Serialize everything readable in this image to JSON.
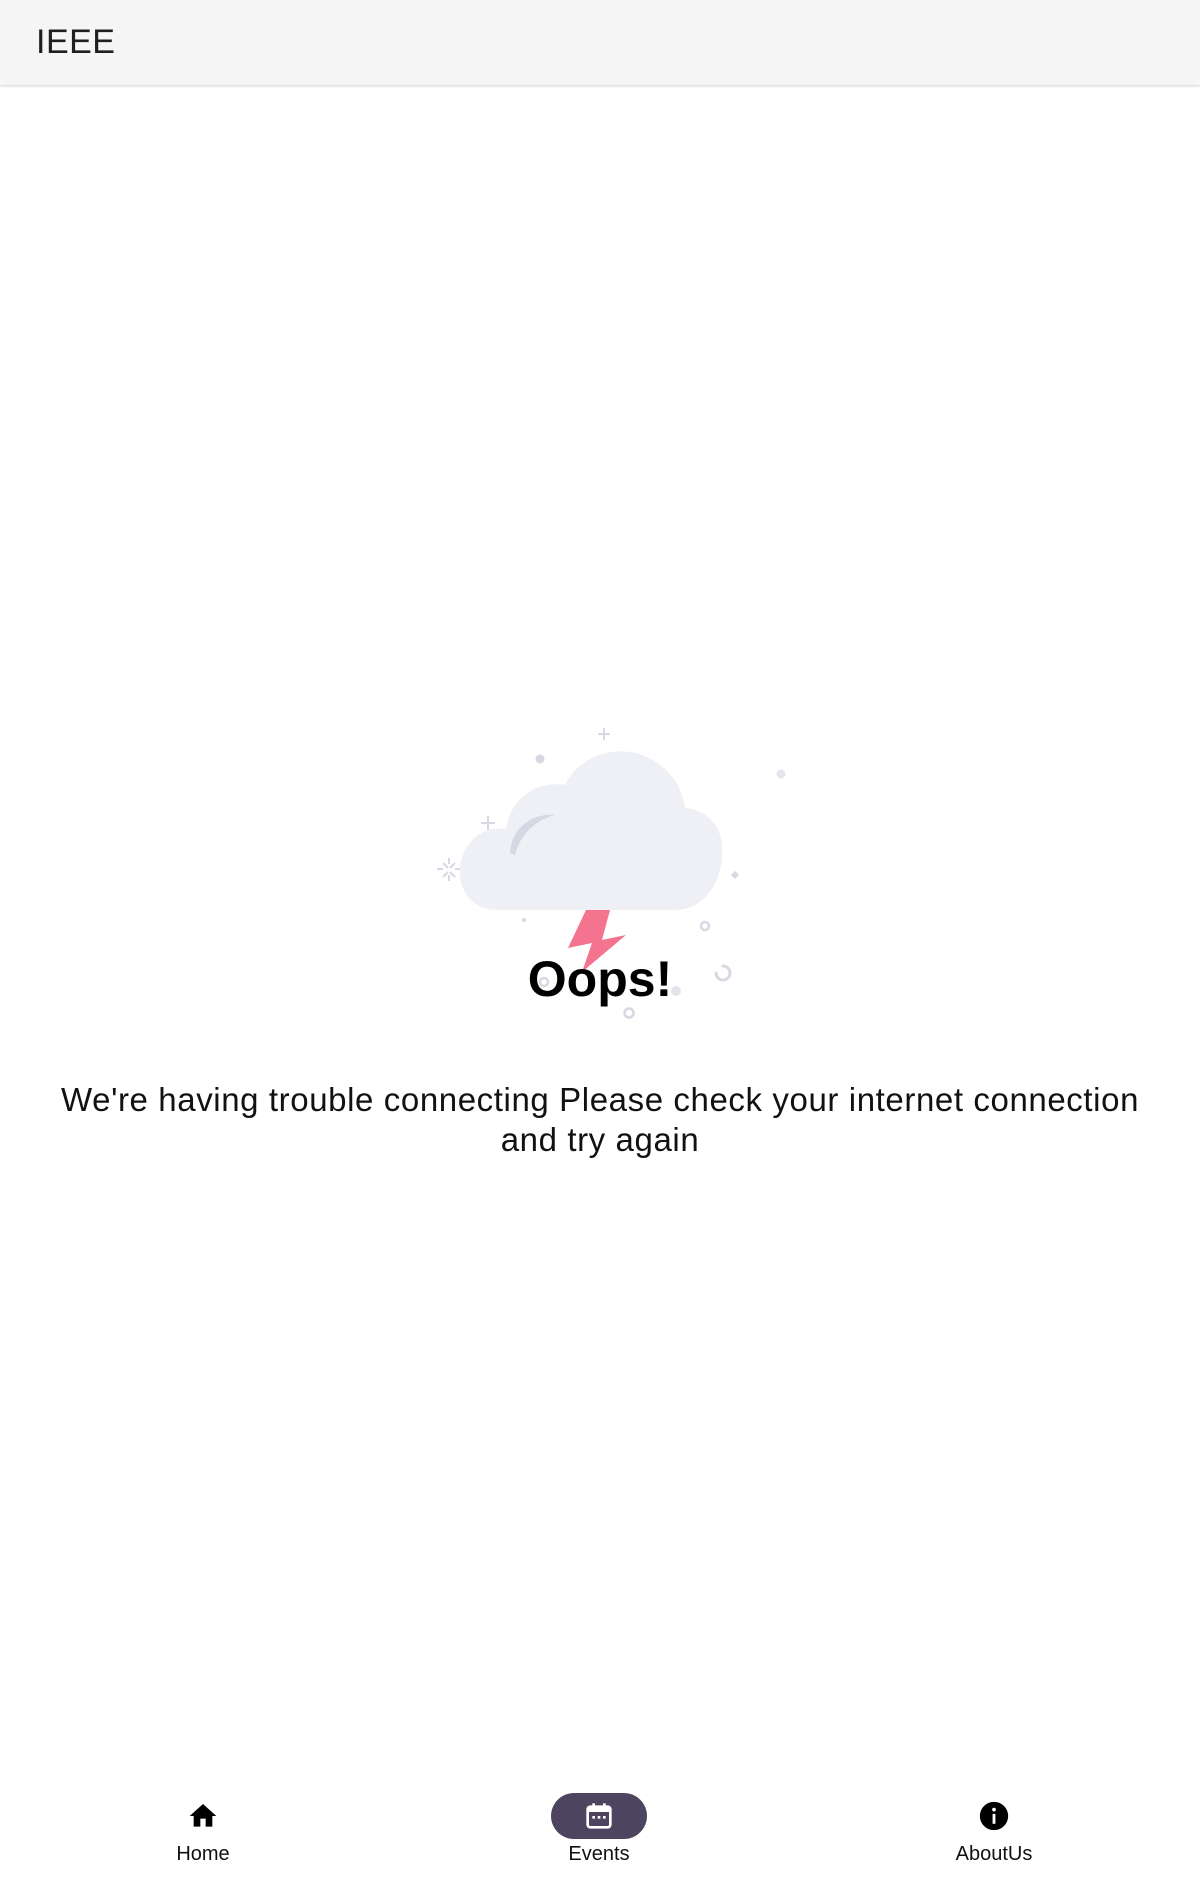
{
  "app_bar": {
    "title": "IEEE"
  },
  "error_state": {
    "heading": "Oops!",
    "message": "We're having trouble connecting Please check your internet connection and try again",
    "illustration": "cloud-lightning-icon"
  },
  "bottom_nav": {
    "items": [
      {
        "label": "Home",
        "icon": "home-icon",
        "active": false
      },
      {
        "label": "Events",
        "icon": "calendar-icon",
        "active": true
      },
      {
        "label": "AboutUs",
        "icon": "info-icon",
        "active": false
      }
    ]
  },
  "colors": {
    "app_bar_bg": "#f5f5f5",
    "active_indicator": "#4d4560",
    "cloud": "#eff0f5",
    "lightning": "#f4738f"
  }
}
